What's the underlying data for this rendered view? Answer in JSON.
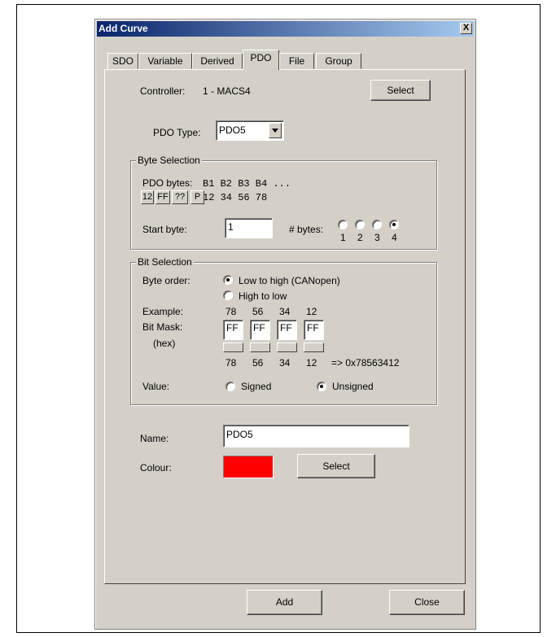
{
  "dialog": {
    "title": "Add Curve",
    "close_symbol": "X"
  },
  "tabs": [
    {
      "label": "SDO"
    },
    {
      "label": "Variable"
    },
    {
      "label": "Derived"
    },
    {
      "label": "PDO"
    },
    {
      "label": "File"
    },
    {
      "label": "Group"
    }
  ],
  "controller": {
    "label": "Controller:",
    "value": "1 - MACS4",
    "select_label": "Select"
  },
  "pdo_type": {
    "label": "PDO Type:",
    "value": "PDO5"
  },
  "byte_selection": {
    "legend": "Byte Selection",
    "bytes_label": "PDO bytes:",
    "bytes_header": "B1 B2 B3 B4 ...",
    "bytes_values": "12 34 56 78",
    "format_buttons": [
      "12",
      "FF",
      "??",
      "P"
    ],
    "start_byte_label": "Start byte:",
    "start_byte_value": "1",
    "num_bytes_label": "# bytes:",
    "num_bytes_options": [
      "1",
      "2",
      "3",
      "4"
    ],
    "num_bytes_selected": "4"
  },
  "bit_selection": {
    "legend": "Bit Selection",
    "byte_order_label": "Byte order:",
    "order_low_high": "Low to high (CANopen)",
    "order_high_low": "High to low",
    "example_label": "Example:",
    "example_values": [
      "78",
      "56",
      "34",
      "12"
    ],
    "bitmask_label": "Bit Mask:",
    "hex_label": "(hex)",
    "mask_values": [
      "FF",
      "FF",
      "FF",
      "FF"
    ],
    "result_values": [
      "78",
      "56",
      "34",
      "12"
    ],
    "result_hex": "=> 0x78563412",
    "value_label": "Value:",
    "signed_label": "Signed",
    "unsigned_label": "Unsigned"
  },
  "name": {
    "label": "Name:",
    "value": "PDO5"
  },
  "colour": {
    "label": "Colour:",
    "swatch": "#ff0000",
    "select_label": "Select"
  },
  "footer": {
    "add_label": "Add",
    "close_label": "Close"
  }
}
